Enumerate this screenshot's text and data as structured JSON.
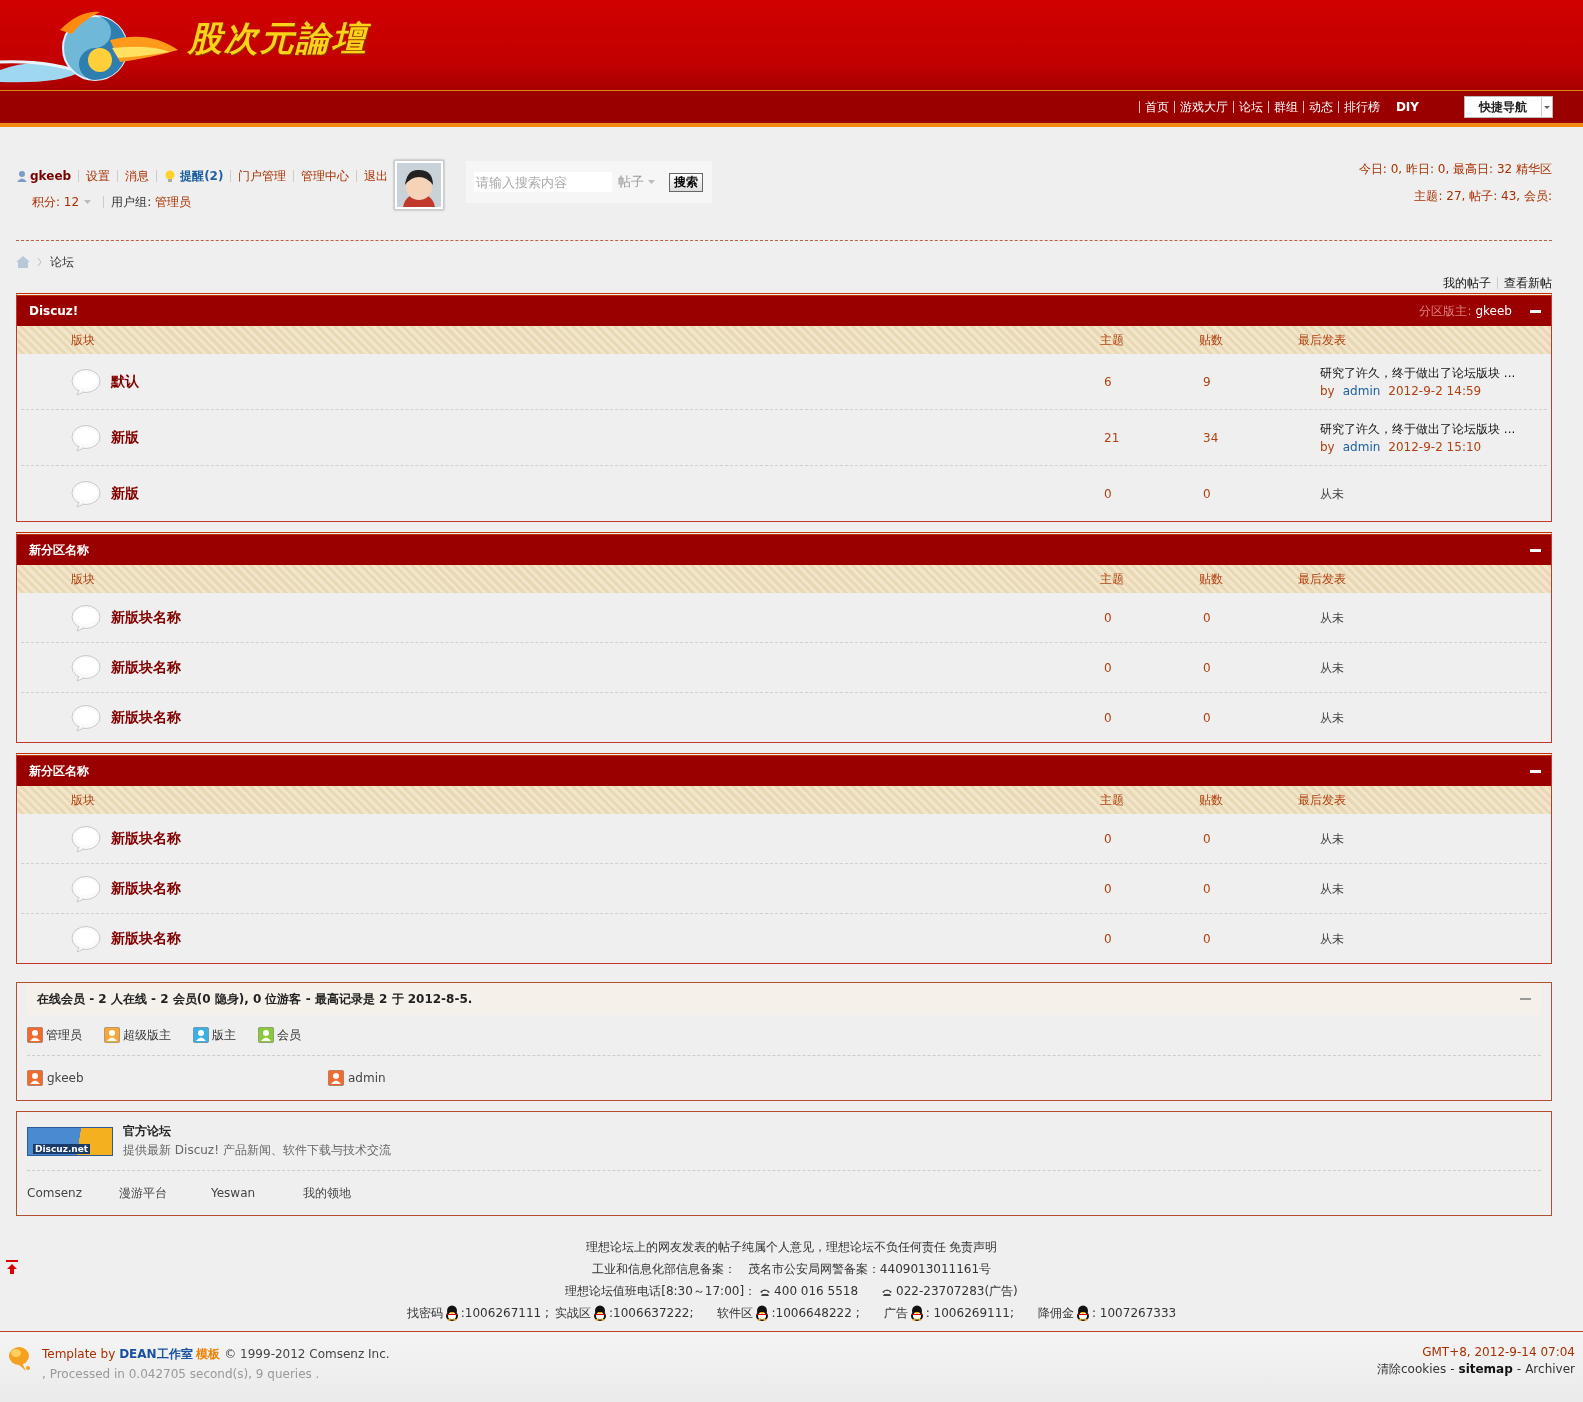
{
  "site": {
    "logo": "股次元論壇"
  },
  "nav": {
    "items": [
      {
        "label": "首页"
      },
      {
        "label": "游戏大厅"
      },
      {
        "label": "论坛"
      },
      {
        "label": "群组"
      },
      {
        "label": "动态"
      },
      {
        "label": "排行榜"
      },
      {
        "label": "DIY"
      }
    ],
    "quick_nav": "快捷导航"
  },
  "user": {
    "name": "gkeeb",
    "links": [
      "设置",
      "消息"
    ],
    "reminder": "提醒(2)",
    "admin_links": [
      "门户管理",
      "管理中心",
      "退出"
    ],
    "credits": "积分: 12",
    "group_label": "用户组:",
    "group": "管理员"
  },
  "search": {
    "placeholder": "请输入搜索内容",
    "scope": "帖子",
    "button": "搜索"
  },
  "stats": {
    "line1": "今日: 0, 昨日: 0, 最高日: 32",
    "digest": "精华区",
    "line2": "主题: 27, 帖子: 43, 会员:"
  },
  "breadcrumb": {
    "current": "论坛"
  },
  "quick_links": [
    "我的帖子",
    "查看新帖"
  ],
  "sections": [
    {
      "title": "Discuz!",
      "moderator_label": "分区版主:",
      "moderator": "gkeeb",
      "columns": [
        "版块",
        "主题",
        "贴数",
        "最后发表"
      ],
      "forums": [
        {
          "name": "默认",
          "topics": "6",
          "posts": "9",
          "last_post": {
            "kind": "post",
            "title": "研究了许久，终于做出了论坛版块 ...",
            "by": "by",
            "author": "admin",
            "time": "2012-9-2 14:59"
          }
        },
        {
          "name": "新版",
          "topics": "21",
          "posts": "34",
          "last_post": {
            "kind": "post",
            "title": "研究了许久，终于做出了论坛版块 ...",
            "by": "by",
            "author": "admin",
            "time": "2012-9-2 15:10"
          }
        },
        {
          "name": "新版",
          "topics": "0",
          "posts": "0",
          "last_post": {
            "kind": "never",
            "text": "从未"
          }
        }
      ]
    },
    {
      "title": "新分区名称",
      "columns": [
        "版块",
        "主题",
        "贴数",
        "最后发表"
      ],
      "forums": [
        {
          "name": "新版块名称",
          "topics": "0",
          "posts": "0",
          "last_post": {
            "kind": "never",
            "text": "从未"
          }
        },
        {
          "name": "新版块名称",
          "topics": "0",
          "posts": "0",
          "last_post": {
            "kind": "never",
            "text": "从未"
          }
        },
        {
          "name": "新版块名称",
          "topics": "0",
          "posts": "0",
          "last_post": {
            "kind": "never",
            "text": "从未"
          }
        }
      ]
    },
    {
      "title": "新分区名称",
      "columns": [
        "版块",
        "主题",
        "贴数",
        "最后发表"
      ],
      "forums": [
        {
          "name": "新版块名称",
          "topics": "0",
          "posts": "0",
          "last_post": {
            "kind": "never",
            "text": "从未"
          }
        },
        {
          "name": "新版块名称",
          "topics": "0",
          "posts": "0",
          "last_post": {
            "kind": "never",
            "text": "从未"
          }
        },
        {
          "name": "新版块名称",
          "topics": "0",
          "posts": "0",
          "last_post": {
            "kind": "never",
            "text": "从未"
          }
        }
      ]
    }
  ],
  "online": {
    "title": "在线会员 - 2 人在线 - 2 会员(0 隐身), 0 位游客 - 最高记录是 2 于 2012-8-5.",
    "legend": [
      {
        "label": "管理员",
        "color": "#f26a2e"
      },
      {
        "label": "超级版主",
        "color": "#f5a83a"
      },
      {
        "label": "版主",
        "color": "#3cb0e4"
      },
      {
        "label": "会员",
        "color": "#8cc83c"
      }
    ],
    "members": [
      {
        "name": "gkeeb",
        "color": "#f26a2e"
      },
      {
        "name": "admin",
        "color": "#f26a2e"
      }
    ]
  },
  "links": {
    "logo_text": "Discuz.net",
    "title": "官方论坛",
    "description": "提供最新 Discuz! 产品新闻、软件下载与技术交流",
    "text_links": [
      "Comsenz",
      "漫游平台",
      "Yeswan",
      "我的领地"
    ]
  },
  "footer": {
    "notice": "理想论坛上的网友发表的帖子纯属个人意见，理想论坛不负任何责任 免责声明",
    "record": "工业和信息化部信息备案：　茂名市公安局网警备案：4409013011161号",
    "hotline_label": "理想论坛值班电话[8:30～17:00]：",
    "phones": [
      "400 016 5518",
      "022-23707283(广告)"
    ],
    "qq": [
      {
        "label": "找密码",
        "number": ":1006267111 ;"
      },
      {
        "label": "实战区",
        "number": ":1006637222;"
      },
      {
        "label": "软件区",
        "number": ":1006648222 ;"
      },
      {
        "label": "广告",
        "number": ": 1006269111;"
      },
      {
        "label": "降佣金",
        "number": ": 1007267333"
      }
    ],
    "template_by": "Template by",
    "studio": "DEAN工作室",
    "template": "模板",
    "copyright": "© 1999-2012 Comsenz Inc.",
    "processed": ", Processed in 0.042705 second(s), 9 queries .",
    "time": "GMT+8, 2012-9-14 07:04",
    "bottom_links": [
      "清除cookies",
      "sitemap",
      "Archiver"
    ],
    "separator": "-"
  }
}
